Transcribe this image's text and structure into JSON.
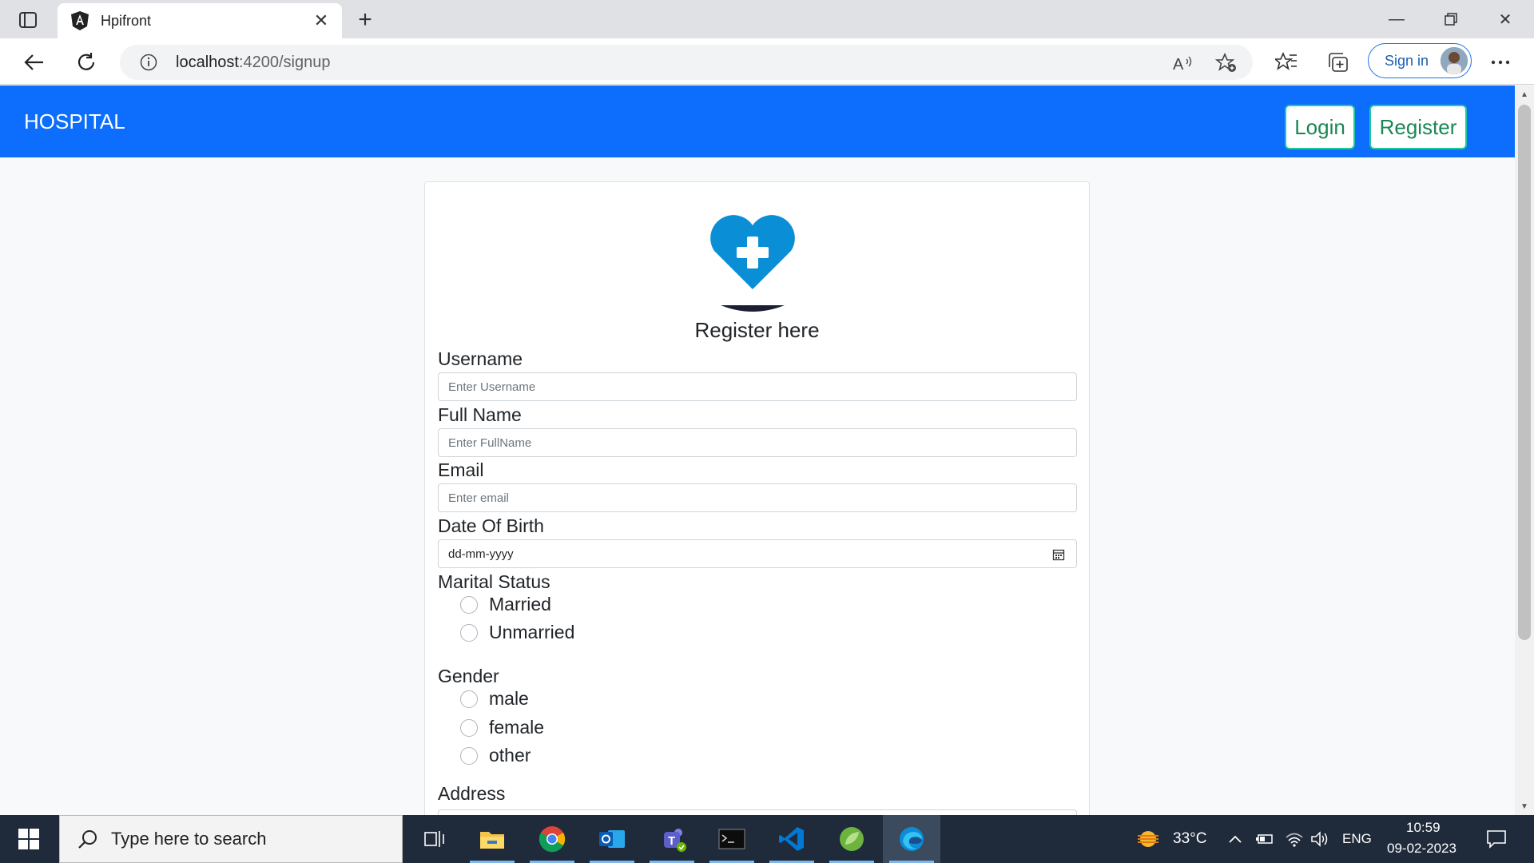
{
  "browser": {
    "tab_title": "Hpifront",
    "url_host": "localhost",
    "url_path": ":4200/signup",
    "sign_in_label": "Sign in"
  },
  "page": {
    "brand": "HOSPITAL",
    "login_label": "Login",
    "register_label": "Register",
    "accent_color": "#0d6efd",
    "button_color": "#198754"
  },
  "form": {
    "title": "Register here",
    "username": {
      "label": "Username",
      "placeholder": "Enter Username"
    },
    "fullname": {
      "label": "Full Name",
      "placeholder": "Enter FullName"
    },
    "email": {
      "label": "Email",
      "placeholder": "Enter email"
    },
    "dob": {
      "label": "Date Of Birth",
      "placeholder": "dd-mm-yyyy"
    },
    "marital_status": {
      "label": "Marital Status",
      "options": [
        "Married",
        "Unmarried"
      ]
    },
    "gender": {
      "label": "Gender",
      "options": [
        "male",
        "female",
        "other"
      ]
    },
    "address": {
      "label": "Address"
    }
  },
  "taskbar": {
    "search_placeholder": "Type here to search",
    "temperature": "33°C",
    "language": "ENG",
    "time": "10:59",
    "date": "09-02-2023"
  }
}
